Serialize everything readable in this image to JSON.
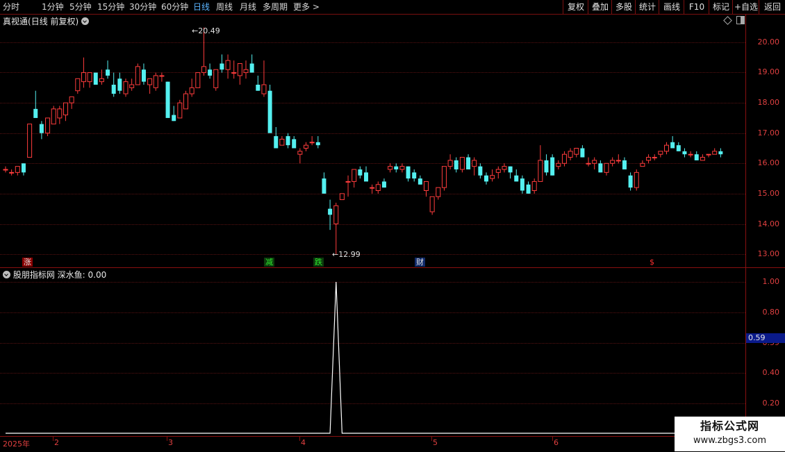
{
  "toolbar": {
    "periods": [
      "分时",
      "1分钟",
      "5分钟",
      "15分钟",
      "30分钟",
      "60分钟",
      "日线",
      "周线",
      "月线",
      "多周期",
      "更多"
    ],
    "active_period": "日线",
    "right_buttons": [
      "复权",
      "叠加",
      "多股",
      "统计",
      "画线",
      "F10",
      "标记",
      "+自选",
      "返回"
    ]
  },
  "main_panel": {
    "title": "真视通",
    "subtitle": "(日线 前复权)",
    "max_label": "20.49",
    "min_label": "12.99",
    "y_axis_labels": [
      "20.00",
      "19.00",
      "18.00",
      "17.00",
      "16.00",
      "15.00",
      "14.00",
      "13.00"
    ],
    "events": [
      {
        "text": "涨",
        "color": "#e0e0e0",
        "bg": "#8a0000"
      },
      {
        "text": "减",
        "color": "#2ee82e",
        "bg": "#0c3a0c"
      },
      {
        "text": "跌",
        "color": "#2ee82e",
        "bg": "#0c3a0c"
      },
      {
        "text": "财",
        "color": "#e0e0e0",
        "bg": "#102a6a"
      },
      {
        "text": "$",
        "color": "#ff3030",
        "bg": "#000000"
      }
    ]
  },
  "sub_panel": {
    "title": "股朋指标网",
    "indicator_name": "深水鱼:",
    "indicator_value": "0.00",
    "y_axis_labels": [
      "1.00",
      "0.80",
      "0.59",
      "0.40",
      "0.20"
    ],
    "cursor_value": "0.59"
  },
  "date_axis": [
    "2025年",
    "2",
    "3",
    "4",
    "5",
    "6"
  ],
  "watermark": {
    "title": "指标公式网",
    "url": "www.zbgs3.com"
  },
  "colors": {
    "up": "#ff3c3c",
    "down": "#54f0f0",
    "axis": "#e04040",
    "grid": "#5a1212",
    "indicator": "#ffffff"
  },
  "chart_data": {
    "type": "candlestick",
    "price_range": [
      12.7,
      20.7
    ],
    "ohlc": [
      [
        15.8,
        15.9,
        15.7,
        15.8
      ],
      [
        15.7,
        15.8,
        15.6,
        15.7
      ],
      [
        15.7,
        15.9,
        15.6,
        15.9
      ],
      [
        16.0,
        16.0,
        15.6,
        15.7
      ],
      [
        16.2,
        17.3,
        16.2,
        17.3
      ],
      [
        17.8,
        18.4,
        17.6,
        17.5
      ],
      [
        17.3,
        17.4,
        16.8,
        17.0
      ],
      [
        17.0,
        17.5,
        16.9,
        17.5
      ],
      [
        17.3,
        17.9,
        17.3,
        17.8
      ],
      [
        17.5,
        17.9,
        17.3,
        17.8
      ],
      [
        17.6,
        18.0,
        17.4,
        18.0
      ],
      [
        18.0,
        18.2,
        17.8,
        18.2
      ],
      [
        18.4,
        18.8,
        18.3,
        18.8
      ],
      [
        18.7,
        19.5,
        18.5,
        19.0
      ],
      [
        18.7,
        19.0,
        18.5,
        19.0
      ],
      [
        19.0,
        19.0,
        18.6,
        18.6
      ],
      [
        18.7,
        19.1,
        18.6,
        18.8
      ],
      [
        19.1,
        19.4,
        18.8,
        18.9
      ],
      [
        18.6,
        19.0,
        18.2,
        18.3
      ],
      [
        18.8,
        19.0,
        18.3,
        18.4
      ],
      [
        18.3,
        18.8,
        18.2,
        18.7
      ],
      [
        18.5,
        18.8,
        18.4,
        18.6
      ],
      [
        18.6,
        19.3,
        18.6,
        19.2
      ],
      [
        19.1,
        19.3,
        18.6,
        18.7
      ],
      [
        18.6,
        18.8,
        18.3,
        18.8
      ],
      [
        18.5,
        19.0,
        18.4,
        18.9
      ],
      [
        18.9,
        19.0,
        18.7,
        18.9
      ],
      [
        18.7,
        18.7,
        17.9,
        17.5
      ],
      [
        17.6,
        17.9,
        17.4,
        17.4
      ],
      [
        17.5,
        18.1,
        17.5,
        18.0
      ],
      [
        17.8,
        18.4,
        17.8,
        18.3
      ],
      [
        18.3,
        18.8,
        18.2,
        18.5
      ],
      [
        18.5,
        19.0,
        18.5,
        19.0
      ],
      [
        19.0,
        20.49,
        18.9,
        19.2
      ],
      [
        19.1,
        19.3,
        18.8,
        18.9
      ],
      [
        18.5,
        19.1,
        18.4,
        19.1
      ],
      [
        19.3,
        19.6,
        19.0,
        19.1
      ],
      [
        19.1,
        19.6,
        18.8,
        19.4
      ],
      [
        19.0,
        19.4,
        18.8,
        19.0
      ],
      [
        18.9,
        19.3,
        18.6,
        19.3
      ],
      [
        19.0,
        19.4,
        18.8,
        19.1
      ],
      [
        19.3,
        19.6,
        19.0,
        19.0
      ],
      [
        18.6,
        18.9,
        18.4,
        18.4
      ],
      [
        18.3,
        19.4,
        18.2,
        18.6
      ],
      [
        18.4,
        18.6,
        17.3,
        17.0
      ],
      [
        16.9,
        17.2,
        16.5,
        16.5
      ],
      [
        16.6,
        16.9,
        16.6,
        16.8
      ],
      [
        16.9,
        17.0,
        16.5,
        16.6
      ],
      [
        16.8,
        16.9,
        16.5,
        16.5
      ],
      [
        16.3,
        16.5,
        16.0,
        16.4
      ],
      [
        16.5,
        16.7,
        16.4,
        16.6
      ],
      [
        16.7,
        16.9,
        16.6,
        16.7
      ],
      [
        16.7,
        16.9,
        16.5,
        16.6
      ],
      [
        15.5,
        15.7,
        15.0,
        15.0
      ],
      [
        14.5,
        14.8,
        13.8,
        14.3
      ],
      [
        14.0,
        14.7,
        12.99,
        14.6
      ],
      [
        14.8,
        15.0,
        14.8,
        15.0
      ],
      [
        15.4,
        15.6,
        14.9,
        15.4
      ],
      [
        15.4,
        15.8,
        15.2,
        15.8
      ],
      [
        15.8,
        15.9,
        15.5,
        15.6
      ],
      [
        15.7,
        15.9,
        15.6,
        15.4
      ],
      [
        15.2,
        15.3,
        15.0,
        15.2
      ],
      [
        15.1,
        15.4,
        15.0,
        15.3
      ],
      [
        15.4,
        15.5,
        15.2,
        15.2
      ],
      [
        15.8,
        16.0,
        15.7,
        15.9
      ],
      [
        15.9,
        16.0,
        15.7,
        15.8
      ],
      [
        15.8,
        16.0,
        15.7,
        15.9
      ],
      [
        15.9,
        15.9,
        15.4,
        15.5
      ],
      [
        15.7,
        15.8,
        15.4,
        15.5
      ],
      [
        15.5,
        15.6,
        15.3,
        15.3
      ],
      [
        15.1,
        15.3,
        14.9,
        15.4
      ],
      [
        14.4,
        14.9,
        14.3,
        14.9
      ],
      [
        14.9,
        15.2,
        14.8,
        15.2
      ],
      [
        15.2,
        15.9,
        15.1,
        15.9
      ],
      [
        15.9,
        16.3,
        15.8,
        16.1
      ],
      [
        16.1,
        16.2,
        15.7,
        15.8
      ],
      [
        15.8,
        16.2,
        15.7,
        16.2
      ],
      [
        16.2,
        16.3,
        15.8,
        15.8
      ],
      [
        15.9,
        16.2,
        15.6,
        16.1
      ],
      [
        15.9,
        16.0,
        15.5,
        15.6
      ],
      [
        15.6,
        15.7,
        15.3,
        15.4
      ],
      [
        15.5,
        15.8,
        15.4,
        15.6
      ],
      [
        15.7,
        15.9,
        15.5,
        15.8
      ],
      [
        15.8,
        16.0,
        15.7,
        15.9
      ],
      [
        15.9,
        15.9,
        15.5,
        15.7
      ],
      [
        15.6,
        15.8,
        15.4,
        15.4
      ],
      [
        15.5,
        15.6,
        15.0,
        15.1
      ],
      [
        15.3,
        15.4,
        15.0,
        15.0
      ],
      [
        15.1,
        15.5,
        15.0,
        15.4
      ],
      [
        15.4,
        16.6,
        15.4,
        16.1
      ],
      [
        16.1,
        16.3,
        15.6,
        15.7
      ],
      [
        16.2,
        16.3,
        15.6,
        15.6
      ],
      [
        15.9,
        16.1,
        15.8,
        16.0
      ],
      [
        16.0,
        16.4,
        15.9,
        16.3
      ],
      [
        16.2,
        16.5,
        16.1,
        16.4
      ],
      [
        16.3,
        16.5,
        16.2,
        16.5
      ],
      [
        16.5,
        16.6,
        16.2,
        16.2
      ],
      [
        16.0,
        16.2,
        15.9,
        16.0
      ],
      [
        16.0,
        16.2,
        15.8,
        16.1
      ],
      [
        16.0,
        16.1,
        15.7,
        15.7
      ],
      [
        15.7,
        16.0,
        15.6,
        16.0
      ],
      [
        16.0,
        16.2,
        15.9,
        16.1
      ],
      [
        16.1,
        16.3,
        16.0,
        16.1
      ],
      [
        16.1,
        16.2,
        15.8,
        15.8
      ],
      [
        15.6,
        15.7,
        15.1,
        15.2
      ],
      [
        15.2,
        15.8,
        15.1,
        15.7
      ],
      [
        15.9,
        16.1,
        15.9,
        16.0
      ],
      [
        16.1,
        16.3,
        16.0,
        16.2
      ],
      [
        16.2,
        16.3,
        16.1,
        16.2
      ],
      [
        16.3,
        16.4,
        16.2,
        16.4
      ],
      [
        16.4,
        16.7,
        16.3,
        16.6
      ],
      [
        16.7,
        16.9,
        16.5,
        16.5
      ],
      [
        16.6,
        16.7,
        16.4,
        16.4
      ],
      [
        16.4,
        16.5,
        16.2,
        16.3
      ],
      [
        16.3,
        16.4,
        16.2,
        16.3
      ],
      [
        16.3,
        16.4,
        16.1,
        16.1
      ],
      [
        16.1,
        16.3,
        16.1,
        16.2
      ],
      [
        16.3,
        16.3,
        16.2,
        16.3
      ],
      [
        16.3,
        16.5,
        16.3,
        16.4
      ],
      [
        16.4,
        16.5,
        16.2,
        16.3
      ]
    ],
    "indicator": {
      "name": "深水鱼",
      "values_note": "all 0 except spike to 1.0 at the bar after the 12.99 low",
      "spike_index": 55,
      "spike_value": 1.0
    }
  }
}
